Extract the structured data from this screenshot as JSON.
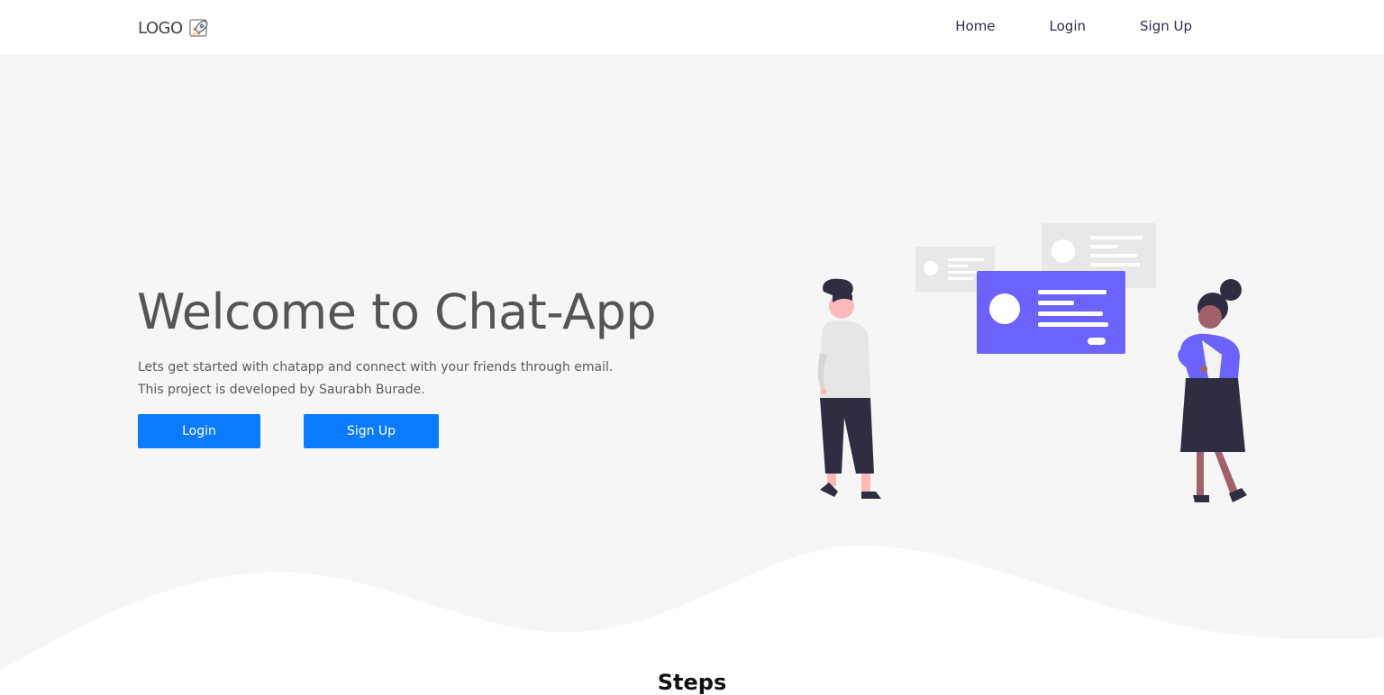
{
  "navbar": {
    "logo_text": "LOGO",
    "logo_icon": "rocket-icon",
    "links": [
      {
        "label": "Home"
      },
      {
        "label": "Login"
      },
      {
        "label": "Sign Up"
      }
    ]
  },
  "hero": {
    "title": "Welcome to Chat-App",
    "description_line1": "Lets get started with chatapp and connect with your friends through email.",
    "description_line2": "This project is developed by Saurabh Burade.",
    "login_button": "Login",
    "signup_button": "Sign Up",
    "illustration": "chat-people-illustration"
  },
  "steps": {
    "heading": "Steps"
  },
  "colors": {
    "accent": "#0a7bff",
    "hero_bg": "#f6f6f6",
    "illustration_purple": "#6c63ff",
    "title_gray": "#555555"
  }
}
